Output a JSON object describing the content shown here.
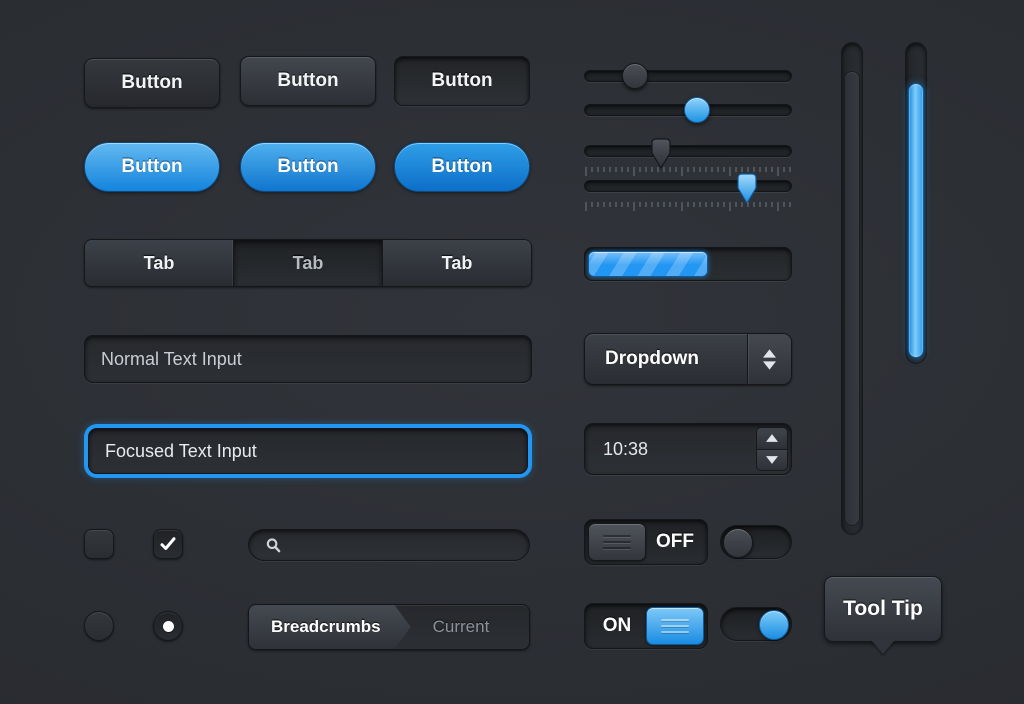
{
  "theme": {
    "background": "#2b2e33",
    "accent": "#2196f3",
    "surface_light": "#454951",
    "surface_dark": "#26282c",
    "text_primary": "#ffffff",
    "text_muted": "#8d939b"
  },
  "buttons_dark": [
    {
      "label": "Button",
      "state": "normal"
    },
    {
      "label": "Button",
      "state": "hover"
    },
    {
      "label": "Button",
      "state": "pressed"
    }
  ],
  "buttons_blue": [
    {
      "label": "Button",
      "state": "normal"
    },
    {
      "label": "Button",
      "state": "hover"
    },
    {
      "label": "Button",
      "state": "pressed"
    }
  ],
  "tabs": [
    {
      "label": "Tab",
      "active": false
    },
    {
      "label": "Tab",
      "active": true
    },
    {
      "label": "Tab",
      "active": false
    }
  ],
  "inputs": {
    "normal": {
      "value": "Normal Text Input",
      "placeholder": "Normal Text Input"
    },
    "focused": {
      "value": "Focused Text Input",
      "placeholder": "Focused Text Input"
    },
    "search": {
      "value": "",
      "placeholder": "",
      "icon": "search-icon"
    }
  },
  "checkbox": {
    "unchecked_label": "",
    "checked_label": "",
    "checked": true,
    "icon": "check-icon"
  },
  "radio": {
    "unselected_label": "",
    "selected_label": "",
    "selected": true
  },
  "breadcrumbs": {
    "items": [
      {
        "label": "Breadcrumbs",
        "active": true
      },
      {
        "label": "Current",
        "active": false
      }
    ]
  },
  "sliders": [
    {
      "name": "slider-round-grey",
      "handle": "round",
      "color": "grey",
      "value": 22
    },
    {
      "name": "slider-round-blue",
      "handle": "round",
      "color": "blue",
      "value": 53
    },
    {
      "name": "slider-pin-grey",
      "handle": "pin",
      "color": "grey",
      "value": 36,
      "ticks": true
    },
    {
      "name": "slider-pin-blue",
      "handle": "pin",
      "color": "blue",
      "value": 78,
      "ticks": true
    }
  ],
  "progress": {
    "value": 60,
    "max": 100,
    "striped": true
  },
  "dropdown": {
    "label": "Dropdown",
    "up_icon": "triangle-up-icon",
    "down_icon": "triangle-down-icon"
  },
  "timefield": {
    "value": "10:38",
    "up_icon": "triangle-up-icon",
    "down_icon": "triangle-down-icon"
  },
  "toggles": [
    {
      "name": "toggle-off",
      "label": "OFF",
      "on": false,
      "handle_side": "left"
    },
    {
      "name": "toggle-on",
      "label": "ON",
      "on": true,
      "handle_side": "right"
    }
  ],
  "switches": [
    {
      "name": "switch-off",
      "on": false
    },
    {
      "name": "switch-on",
      "on": true
    }
  ],
  "scrollbars": [
    {
      "name": "scrollbar-grey",
      "color": "grey",
      "thumb_percent": 82
    },
    {
      "name": "scrollbar-blue",
      "color": "blue",
      "thumb_percent": 85
    }
  ],
  "tooltip": {
    "label": "Tool Tip",
    "arrow": "down"
  }
}
